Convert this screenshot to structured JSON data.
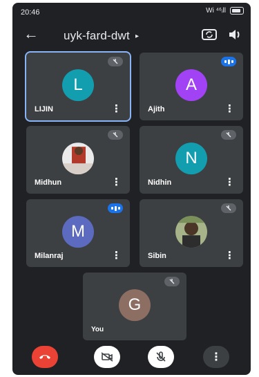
{
  "status_bar": {
    "time": "20:46",
    "right_text": "Wi ⁴⁶ᵢll"
  },
  "appbar": {
    "meeting_code": "uyk-fard-dwt",
    "tri": "▸"
  },
  "tiles": [
    {
      "name": "LIJIN",
      "initial": "L",
      "color": "#129eaf",
      "status": "muted"
    },
    {
      "name": "Ajith",
      "initial": "A",
      "color": "#a142f4",
      "status": "speaking"
    },
    {
      "name": "Midhun",
      "initial": "",
      "color": "",
      "status": "muted"
    },
    {
      "name": "Nidhin",
      "initial": "N",
      "color": "#129eaf",
      "status": "muted"
    },
    {
      "name": "Milanraj",
      "initial": "M",
      "color": "#5c6bc0",
      "status": "speaking"
    },
    {
      "name": "Sibin",
      "initial": "",
      "color": "",
      "status": "muted"
    },
    {
      "name": "You",
      "initial": "G",
      "color": "#8d6e63",
      "status": "muted"
    }
  ],
  "more_glyph": "⋮",
  "controls": {
    "overflow_glyph": "⋮"
  },
  "icons": {
    "back": "arrow-left-icon",
    "swap": "switch-camera-icon",
    "speaker": "speaker-icon",
    "mute": "mic-off-icon",
    "speaking": "audio-bars-icon",
    "end": "end-call-icon",
    "camera_off": "camera-off-icon",
    "mic_off": "mic-off-icon"
  },
  "colors": {
    "background": "#202124",
    "tile": "#3c4043",
    "accent": "#8ab4f8",
    "end_call": "#ea4335"
  }
}
